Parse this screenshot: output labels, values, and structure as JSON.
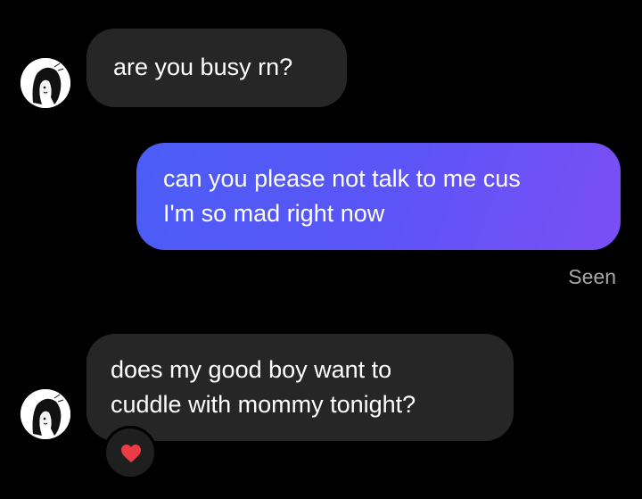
{
  "conversation": {
    "messages": [
      {
        "sender": "them",
        "lines": [
          "are you busy rn?"
        ]
      },
      {
        "sender": "me",
        "lines": [
          "can you please not talk to me cus",
          "I'm so mad right now"
        ],
        "status": "Seen"
      },
      {
        "sender": "them",
        "lines": [
          "does my good boy want to",
          "cuddle with mommy tonight?"
        ],
        "reaction": "heart-icon"
      }
    ]
  },
  "colors": {
    "background": "#000000",
    "incoming_bubble": "#262626",
    "outgoing_gradient_start": "#4f5cf7",
    "outgoing_gradient_end": "#7a4ef5",
    "status_text": "#a8a8a8",
    "reaction_heart": "#ed3b45"
  }
}
